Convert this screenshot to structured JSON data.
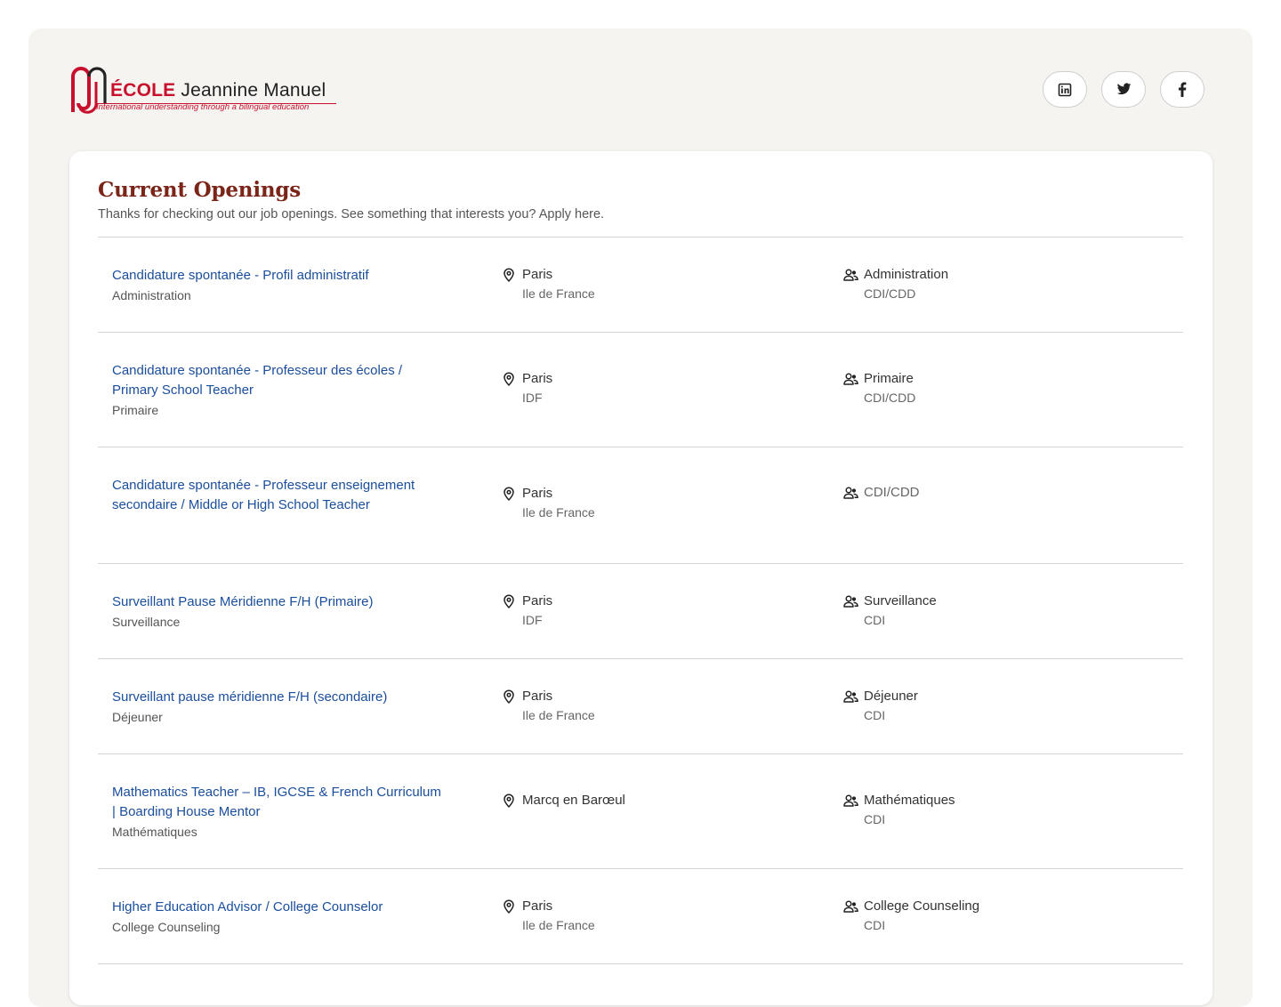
{
  "logo": {
    "word_ecole": "ÉCOLE",
    "word_name": "Jeannine Manuel",
    "tagline": "International understanding through a bilingual education"
  },
  "socials": [
    {
      "icon": "linkedin-icon"
    },
    {
      "icon": "twitter-icon"
    },
    {
      "icon": "facebook-icon"
    }
  ],
  "colors": {
    "brand_red": "#c8102e",
    "title_color": "#7b2518",
    "link_color": "#1a4e9c",
    "page_bg": "#f5f4f1"
  },
  "openings": {
    "title": "Current Openings",
    "subtitle": "Thanks for checking out our job openings. See something that interests you? Apply here.",
    "jobs": [
      {
        "title": "Candidature spontanée - Profil administratif",
        "department": "Administration",
        "city": "Paris",
        "region": "Ile de France",
        "category": "Administration",
        "contract": "CDI/CDD"
      },
      {
        "title": "Candidature spontanée - Professeur des écoles / Primary School Teacher",
        "department": "Primaire",
        "city": "Paris",
        "region": "IDF",
        "category": "Primaire",
        "contract": "CDI/CDD"
      },
      {
        "title": "Candidature spontanée - Professeur enseignement secondaire / Middle or High School Teacher",
        "department": "",
        "city": "Paris",
        "region": "Ile de France",
        "category": "CDI/CDD",
        "contract": ""
      },
      {
        "title": "Surveillant Pause Méridienne F/H (Primaire)",
        "department": "Surveillance",
        "city": "Paris",
        "region": "IDF",
        "category": "Surveillance",
        "contract": "CDI"
      },
      {
        "title": "Surveillant pause méridienne F/H (secondaire)",
        "department": "Déjeuner",
        "city": "Paris",
        "region": "Ile de France",
        "category": "Déjeuner",
        "contract": "CDI"
      },
      {
        "title": "Mathematics Teacher – IB, IGCSE & French Curriculum | Boarding House Mentor",
        "department": "Mathématiques",
        "city": "Marcq en Barœul",
        "region": "",
        "category": "Mathématiques",
        "contract": "CDI"
      },
      {
        "title": "Higher Education Advisor / College Counselor",
        "department": "College Counseling",
        "city": "Paris",
        "region": "Ile de France",
        "category": "College Counseling",
        "contract": "CDI"
      }
    ]
  }
}
